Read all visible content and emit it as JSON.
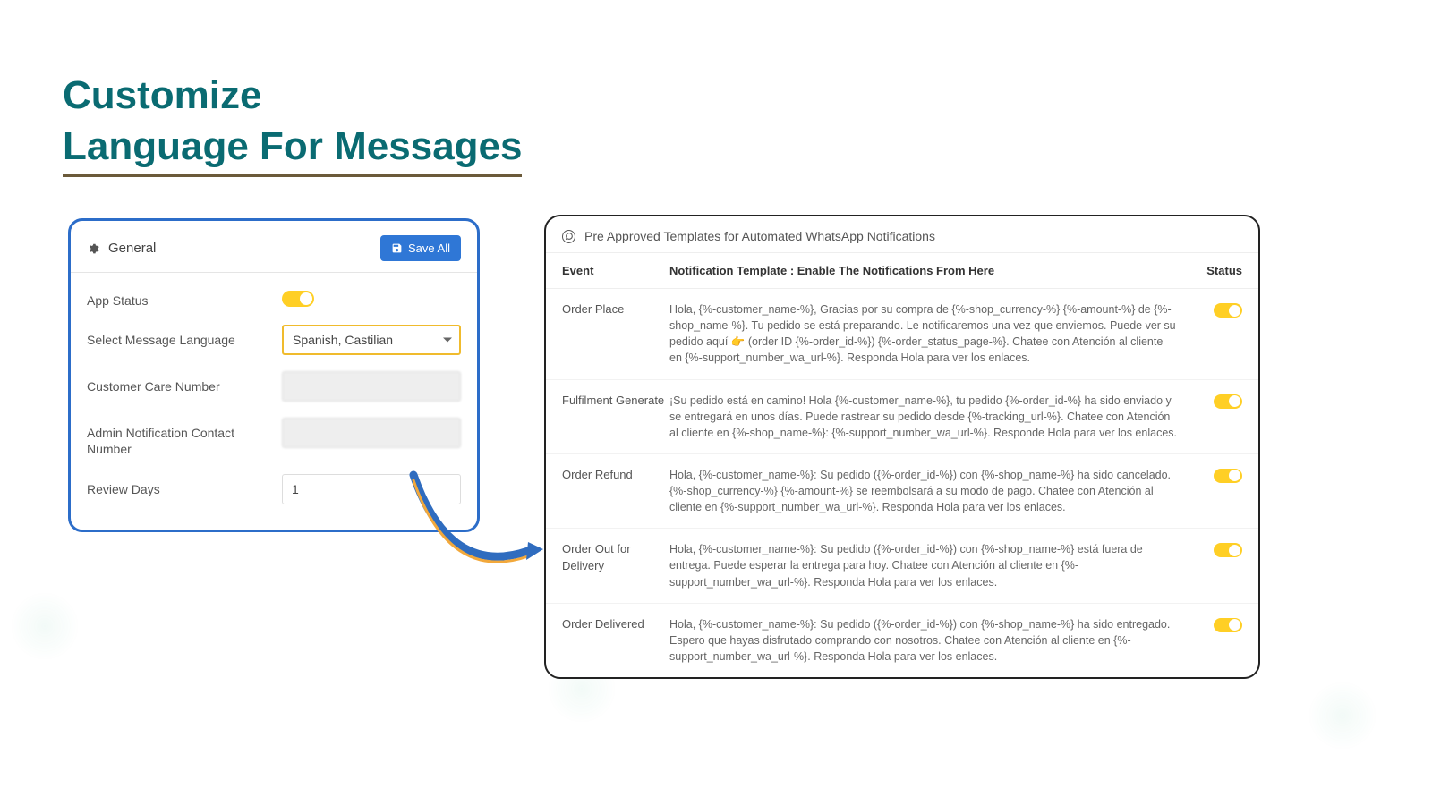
{
  "title_line1": "Customize",
  "title_line2": "Language For Messages",
  "general": {
    "header": "General",
    "save_button": "Save All",
    "fields": {
      "app_status_label": "App Status",
      "language_label": "Select Message Language",
      "language_value": "Spanish, Castilian",
      "care_number_label": "Customer Care Number",
      "care_number_value": "",
      "admin_label": "Admin Notification Contact Number",
      "admin_value": "",
      "review_days_label": "Review Days",
      "review_days_value": "1"
    }
  },
  "templates": {
    "header": "Pre Approved Templates for Automated WhatsApp Notifications",
    "columns": {
      "event": "Event",
      "template": "Notification Template : Enable The Notifications From Here",
      "status": "Status"
    },
    "rows": [
      {
        "event": "Order Place",
        "template": "Hola, {%-customer_name-%}, Gracias por su compra de {%-shop_currency-%} {%-amount-%} de {%-shop_name-%}. Tu pedido se está preparando. Le notificaremos una vez que enviemos. Puede ver su pedido aquí 👉 (order ID {%-order_id-%}) {%-order_status_page-%}. Chatee con Atención al cliente en {%-support_number_wa_url-%}. Responda Hola para ver los enlaces."
      },
      {
        "event": "Fulfilment Generate",
        "template": "¡Su pedido está en camino! Hola {%-customer_name-%}, tu pedido {%-order_id-%} ha sido enviado y se entregará en unos días. Puede rastrear su pedido desde {%-tracking_url-%}. Chatee con Atención al cliente en {%-shop_name-%}: {%-support_number_wa_url-%}. Responde Hola para ver los enlaces."
      },
      {
        "event": "Order Refund",
        "template": "Hola, {%-customer_name-%}: Su pedido ({%-order_id-%}) con {%-shop_name-%} ha sido cancelado. {%-shop_currency-%} {%-amount-%} se reembolsará a su modo de pago. Chatee con Atención al cliente en {%-support_number_wa_url-%}. Responda Hola para ver los enlaces."
      },
      {
        "event": "Order Out for Delivery",
        "template": "Hola, {%-customer_name-%}: Su pedido ({%-order_id-%}) con {%-shop_name-%} está fuera de entrega. Puede esperar la entrega para hoy. Chatee con Atención al cliente en {%-support_number_wa_url-%}. Responda Hola para ver los enlaces."
      },
      {
        "event": "Order Delivered",
        "template": "Hola, {%-customer_name-%}: Su pedido ({%-order_id-%}) con {%-shop_name-%} ha sido entregado. Espero que hayas disfrutado comprando con nosotros. Chatee con Atención al cliente en {%-support_number_wa_url-%}. Responda Hola para ver los enlaces."
      }
    ]
  }
}
